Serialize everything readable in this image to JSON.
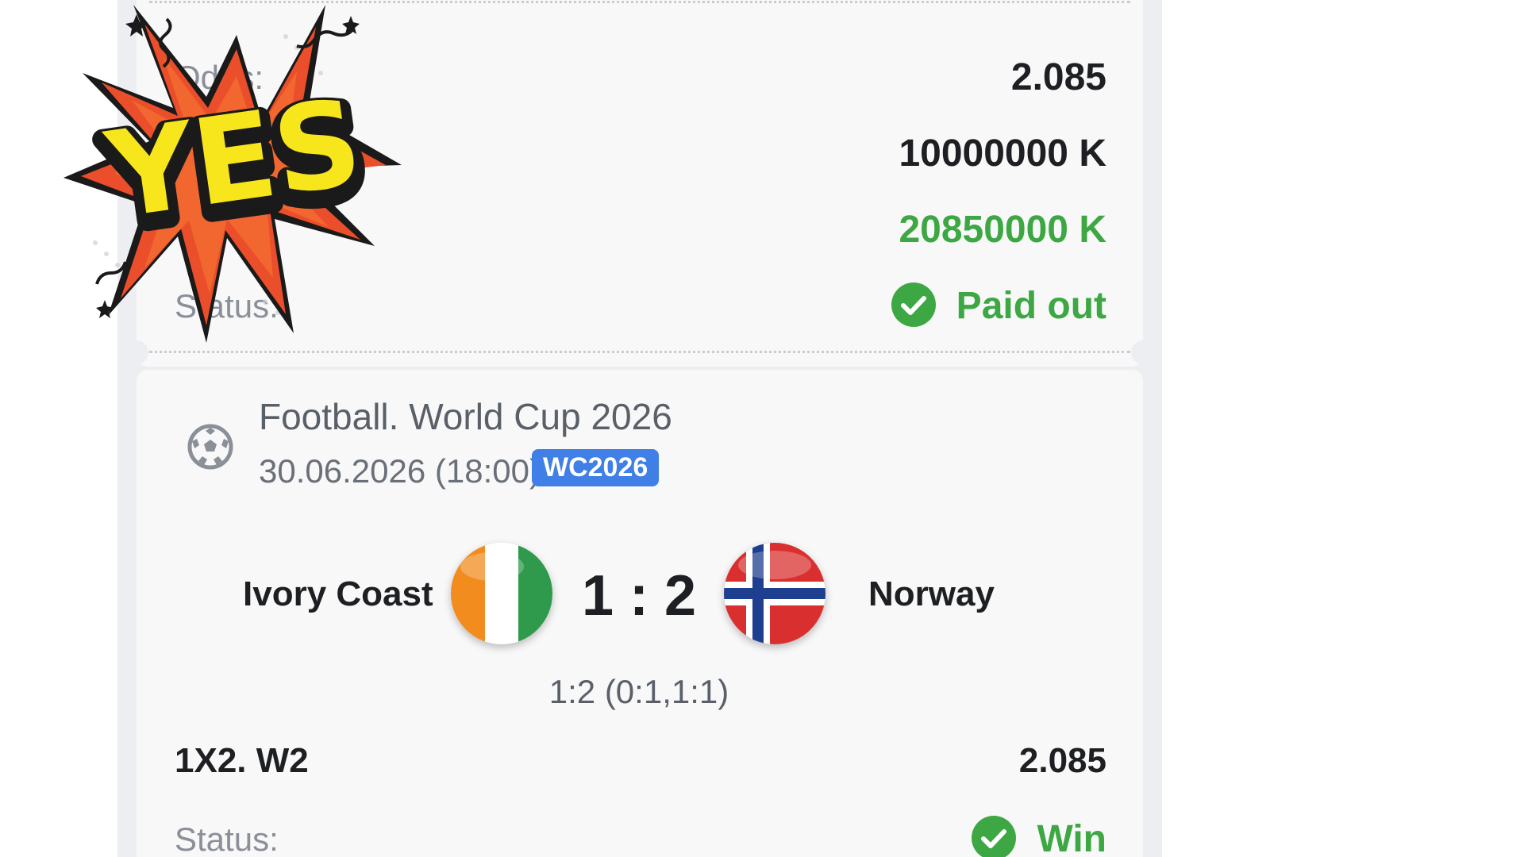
{
  "summary": {
    "odds_label": "Odds:",
    "odds_value": "2.085",
    "stake_value": "10000000 K",
    "payout_value": "20850000 K",
    "status_label": "Status:",
    "status_value": "Paid out"
  },
  "event": {
    "title": "Football. World Cup 2026",
    "date": "30.06.2026 (18:00)",
    "tag": "WC2026",
    "home_team": "Ivory Coast",
    "away_team": "Norway",
    "score": "1 : 2",
    "score_detail": "1:2 (0:1,1:1)",
    "market": "1X2. W2",
    "market_odds": "2.085",
    "status_label": "Status:",
    "status_value": "Win"
  },
  "sticker": {
    "text": "YES"
  },
  "colors": {
    "win_green": "#3da843",
    "tag_blue": "#3f7fe6",
    "burst_red": "#ea4e2a",
    "burst_yellow": "#f7e61c"
  },
  "icons": [
    "soccer-ball-icon",
    "check-circle-icon",
    "ivory-coast-flag-icon",
    "norway-flag-icon"
  ]
}
